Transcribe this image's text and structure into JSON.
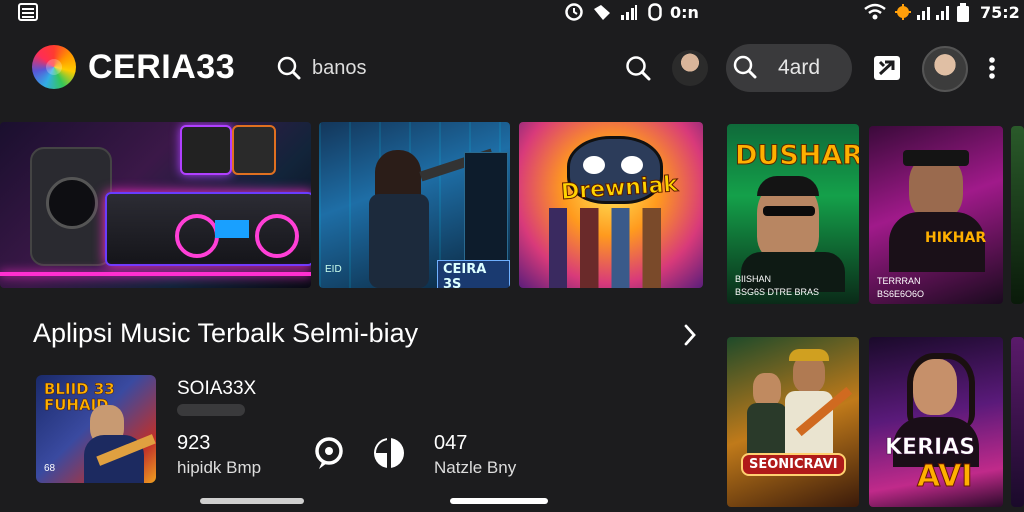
{
  "status_bar": {
    "left_text": "0:n",
    "time": "75:2"
  },
  "header": {
    "brand": "CERIA33",
    "search_text": "banos",
    "search_pill_text": "4ard"
  },
  "top_covers": [
    {
      "id": "studio",
      "label": ""
    },
    {
      "id": "arcade",
      "label": "CEIRA 3S",
      "tag": "EID"
    },
    {
      "id": "cat",
      "label": "Drewniak"
    },
    {
      "id": "dushar",
      "title": "DUSHAR",
      "line1": "BIISHAN",
      "line2": "BSG6S DTRE BRAS"
    },
    {
      "id": "hikhar",
      "title": "HIKHAR",
      "line1": "TERRRAN",
      "line2": "BS6E6O6O"
    }
  ],
  "section": {
    "heading": "Aplipsi Music Terbalk Selmi-biay"
  },
  "now_playing": {
    "art_title": "BLIID 33 FUHAID",
    "art_tag": "68",
    "title": "SOIA33X",
    "count1": "923",
    "sub1": "hipidk Bmp",
    "count2": "047",
    "sub2": "Natzle Bny"
  },
  "bottom_covers": [
    {
      "id": "seonicravi",
      "title": "SEONICRAVI"
    },
    {
      "id": "kerias",
      "title": "KERIAS",
      "sub": "AVI"
    }
  ],
  "colors": {
    "background": "#1c1c1e",
    "pill": "#3a3a3c",
    "text": "#ffffff"
  },
  "icons": [
    "menu-icon",
    "clock-icon",
    "wifi-icon",
    "signal-icon",
    "battery-icon",
    "search-icon",
    "cast-icon",
    "more-vert-icon",
    "chevron-right-icon",
    "chat-icon",
    "share-icon"
  ]
}
